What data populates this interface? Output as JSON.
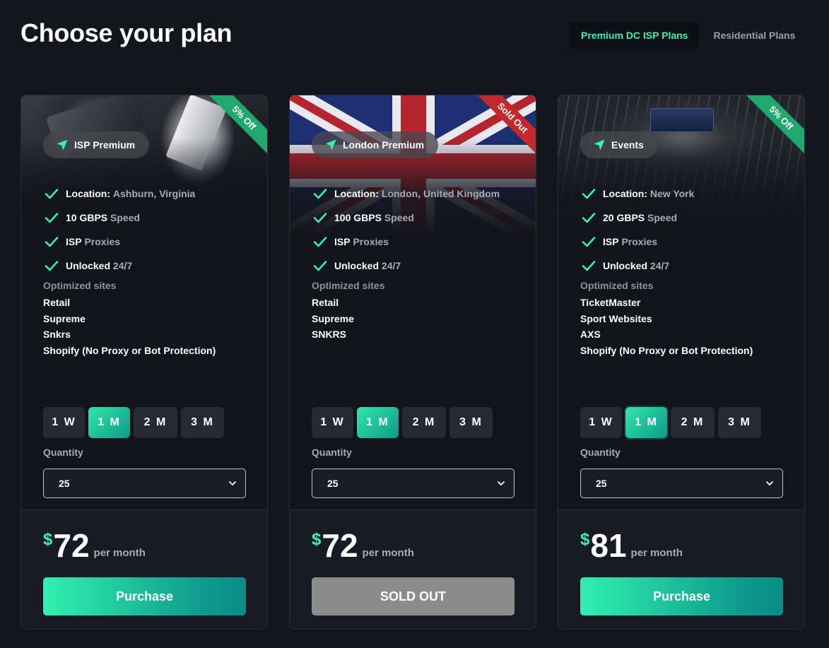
{
  "page_title": "Choose your plan",
  "tabs": [
    {
      "label": "Premium DC ISP Plans",
      "active": true
    },
    {
      "label": "Residential Plans",
      "active": false
    }
  ],
  "colors": {
    "accent": "#36f3b1",
    "ribbon_green": "#21a86f",
    "ribbon_red": "#c2292d",
    "sold_out_button": "#8c8c8c"
  },
  "cards": [
    {
      "ribbon": "5% Off",
      "plan_name": "ISP Premium",
      "features": [
        {
          "key": "Location:",
          "value": "Ashburn, Virginia"
        },
        {
          "key": "10 GBPS",
          "value": "Speed"
        },
        {
          "key": "ISP",
          "value": "Proxies"
        },
        {
          "key": "Unlocked",
          "value": "24/7"
        }
      ],
      "sites_title": "Optimized sites",
      "sites": [
        "Retail",
        "Supreme",
        "Snkrs",
        "Shopify (No Proxy or Bot Protection)"
      ],
      "durations": [
        "1 W",
        "1 M",
        "2 M",
        "3 M"
      ],
      "selected_duration": "1 M",
      "quantity_label": "Quantity",
      "quantity": "25",
      "currency": "$",
      "price": "72",
      "per": "per month",
      "button": "Purchase"
    },
    {
      "ribbon": "Sold Out",
      "plan_name": "London Premium",
      "features": [
        {
          "key": "Location:",
          "value": "London, United Kingdom"
        },
        {
          "key": "100 GBPS",
          "value": "Speed"
        },
        {
          "key": "ISP",
          "value": "Proxies"
        },
        {
          "key": "Unlocked",
          "value": "24/7"
        }
      ],
      "sites_title": "Optimized sites",
      "sites": [
        "Retail",
        "Supreme",
        "SNKRS"
      ],
      "durations": [
        "1 W",
        "1 M",
        "2 M",
        "3 M"
      ],
      "selected_duration": "1 M",
      "quantity_label": "Quantity",
      "quantity": "25",
      "currency": "$",
      "price": "72",
      "per": "per month",
      "button": "SOLD OUT"
    },
    {
      "ribbon": "5% Off",
      "plan_name": "Events",
      "features": [
        {
          "key": "Location:",
          "value": "New York"
        },
        {
          "key": "20 GBPS",
          "value": "Speed"
        },
        {
          "key": "ISP",
          "value": "Proxies"
        },
        {
          "key": "Unlocked",
          "value": "24/7"
        }
      ],
      "sites_title": "Optimized sites",
      "sites": [
        "TicketMaster",
        "Sport Websites",
        "AXS",
        "Shopify (No Proxy or Bot Protection)"
      ],
      "durations": [
        "1 W",
        "1 M",
        "2 M",
        "3 M"
      ],
      "selected_duration": "1 M",
      "quantity_label": "Quantity",
      "quantity": "25",
      "currency": "$",
      "price": "81",
      "per": "per month",
      "button": "Purchase"
    }
  ]
}
